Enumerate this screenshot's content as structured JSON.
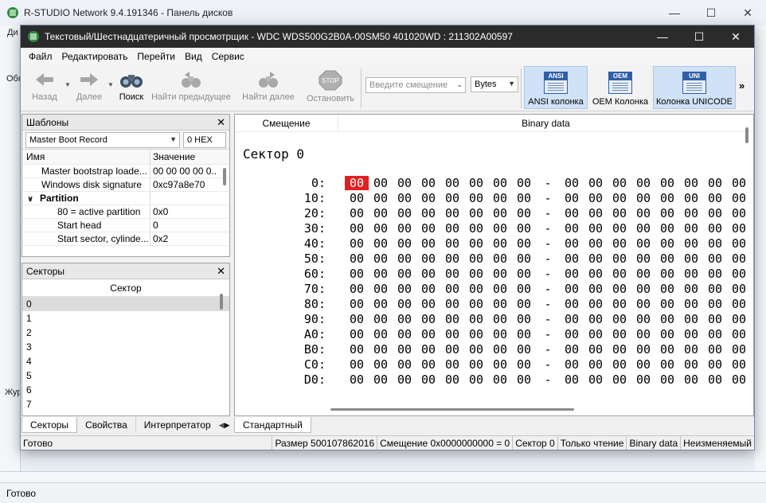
{
  "background": {
    "title": "R-STUDIO Network 9.4.191346 - Панель дисков",
    "menu_stub": "Ди",
    "stub1": "Обн",
    "stub2": "Жур",
    "status": "Готово"
  },
  "window": {
    "title": "Текстовый/Шестнадцатеричный просмотрщик - WDC WDS500G2B0A-00SM50 401020WD : 211302A00597"
  },
  "menu": [
    "Файл",
    "Редактировать",
    "Перейти",
    "Вид",
    "Сервис"
  ],
  "toolbar": {
    "back": "Назад",
    "forward": "Далее",
    "search": "Поиск",
    "find_prev": "Найти предыдущее",
    "find_next": "Найти далее",
    "stop": "Остановить",
    "offset_placeholder": "Введите смещение",
    "unit": "Bytes",
    "ansi": "ANSI колонка",
    "oem": "OEM Колонка",
    "unicode": "Колонка UNICODE",
    "ansi_icon": "ANSI",
    "oem_icon": "OEM",
    "uni_icon": "UNI",
    "stop_icon": "STOP",
    "more": "»"
  },
  "templates": {
    "title": "Шаблоны",
    "selected": "Master Boot Record",
    "offset": "0 HEX",
    "col_name": "Имя",
    "col_value": "Значение",
    "rows": [
      {
        "name": "Master bootstrap loade...",
        "value": "00 00 00 00 0..."
      },
      {
        "name": "Windows disk signature",
        "value": "0xc97a8e70"
      },
      {
        "name": "Partition",
        "value": ""
      },
      {
        "name": "80 = active partition",
        "value": "0x0"
      },
      {
        "name": "Start head",
        "value": "0"
      },
      {
        "name": "Start sector, cylinde...",
        "value": "0x2"
      }
    ]
  },
  "sectors": {
    "title": "Секторы",
    "col": "Сектор",
    "items": [
      "0",
      "1",
      "2",
      "3",
      "4",
      "5",
      "6",
      "7"
    ]
  },
  "left_tabs": [
    "Секторы",
    "Свойства",
    "Интерпретатор"
  ],
  "hex_view": {
    "col_offset": "Смещение",
    "col_binary": "Binary data",
    "sector_label": "Сектор 0",
    "offsets": [
      "0:",
      "10:",
      "20:",
      "30:",
      "40:",
      "50:",
      "60:",
      "70:",
      "80:",
      "90:",
      "A0:",
      "B0:",
      "C0:",
      "D0:"
    ],
    "byte": "00",
    "dash": "-"
  },
  "right_tabs": [
    "Стандартный"
  ],
  "status": {
    "ready": "Готово",
    "size": "Размер 500107862016",
    "offset": "Смещение 0x0000000000 = 0",
    "sector": "Сектор 0",
    "readonly": "Только чтение",
    "binary": "Binary data",
    "unchanged": "Неизменяемый"
  }
}
